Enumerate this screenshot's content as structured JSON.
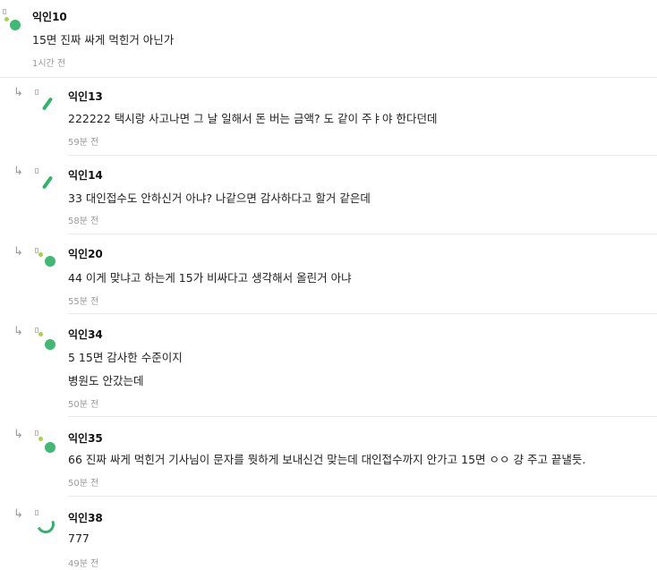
{
  "comments": [
    {
      "author": "익인10",
      "lines": [
        "15면 진짜 싸게 먹힌거 아닌가"
      ],
      "time": "1시간 전"
    },
    {
      "author": "익인13",
      "lines": [
        "222222 택시랑 사고나면 그 날 일해서 돈 버는 금액? 도 같이 주ㅑ야 한다던데"
      ],
      "time": "59분 전"
    },
    {
      "author": "익인14",
      "lines": [
        "33 대인접수도 안하신거 아냐? 나같으면 감사하다고 할거 같은데"
      ],
      "time": "58분 전"
    },
    {
      "author": "익인20",
      "lines": [
        "44 이게 맞냐고 하는게 15가 비싸다고 생각해서 올린거 아냐"
      ],
      "time": "55분 전"
    },
    {
      "author": "익인34",
      "lines": [
        "5 15면 감사한 수준이지",
        "병원도 안갔는데"
      ],
      "time": "50분 전"
    },
    {
      "author": "익인35",
      "lines": [
        "66 진짜 싸게 먹힌거 기사님이 문자를 뭣하게 보내신건 맞는데 대인접수까지 안가고 15면 ㅇㅇ 걍 주고 끝낼듯."
      ],
      "time": "50분 전"
    },
    {
      "author": "익인38",
      "lines": [
        "777"
      ],
      "time": "49분 전"
    }
  ],
  "icons": {
    "reply": "reply-arrow-icon",
    "avatar": "avatar-icon"
  },
  "colors": {
    "accent_green": "#3fba73",
    "lime": "#a6d63d",
    "muted": "#9a9a9a"
  }
}
